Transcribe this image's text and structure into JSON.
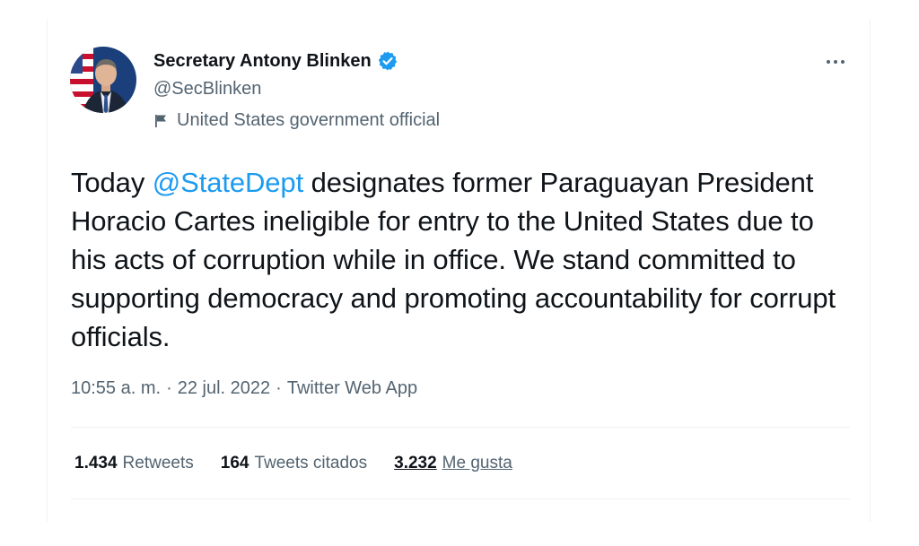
{
  "tweet": {
    "author": {
      "display_name": "Secretary Antony Blinken",
      "handle": "@SecBlinken",
      "label": "United States government official"
    },
    "icons": {
      "verified": "verified-badge-icon",
      "label": "flag-icon",
      "more": "more-options-icon",
      "avatar": "profile-photo"
    },
    "text": {
      "before_mention": "Today ",
      "mention": "@StateDept",
      "after_mention": " designates former Paraguayan President Horacio Cartes ineligible for entry to the United States due to his acts of corruption while in office. We stand committed to supporting democracy and promoting accountability for corrupt officials."
    },
    "meta": {
      "time": "10:55 a. m.",
      "separator1": "·",
      "date": "22 jul. 2022",
      "separator2": "·",
      "source": "Twitter Web App"
    },
    "stats": {
      "retweets": {
        "count": "1.434",
        "label": "Retweets"
      },
      "quotes": {
        "count": "164",
        "label": "Tweets citados"
      },
      "likes": {
        "count": "3.232",
        "label": "Me gusta"
      }
    },
    "colors": {
      "accent": "#1d9bf0",
      "text": "#0f1419",
      "secondary": "#536471",
      "divider": "#eff3f4"
    }
  }
}
